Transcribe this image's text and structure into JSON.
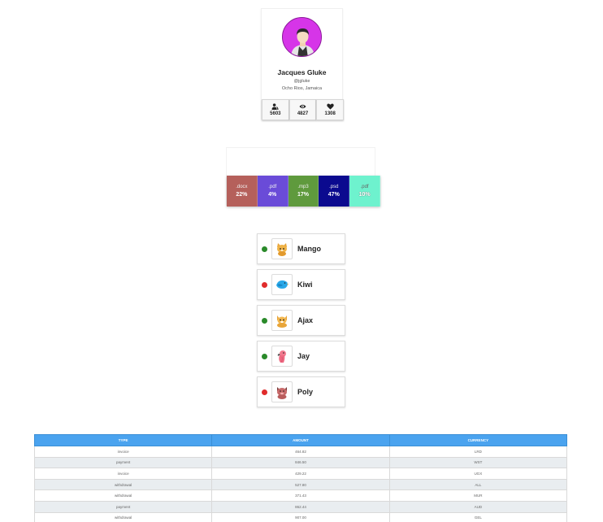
{
  "profile": {
    "name": "Jacques Gluke",
    "handle": "@jgluke",
    "location": "Ocho Rios, Jamaica",
    "avatar_color": "#d635e8",
    "stats": [
      {
        "icon": "followers-icon",
        "value": "5603"
      },
      {
        "icon": "eye-icon",
        "value": "4827"
      },
      {
        "icon": "heart-icon",
        "value": "1308"
      }
    ]
  },
  "file_types": [
    {
      "ext": ".docx",
      "percent": "22%",
      "color": "#b5605b"
    },
    {
      "ext": ".pdf",
      "percent": "4%",
      "color": "#6a4bd8"
    },
    {
      "ext": ".mp3",
      "percent": "17%",
      "color": "#5f9a3d"
    },
    {
      "ext": ".psd",
      "percent": "47%",
      "color": "#0b0a8f"
    },
    {
      "ext": ".pdf",
      "percent": "10%",
      "color": "#6ef2ce"
    }
  ],
  "pets": [
    {
      "name": "Mango",
      "status_color": "#2a8a2a",
      "icon": "cat-icon"
    },
    {
      "name": "Kiwi",
      "status_color": "#e02b2b",
      "icon": "bird-icon"
    },
    {
      "name": "Ajax",
      "status_color": "#2a8a2a",
      "icon": "dog-icon"
    },
    {
      "name": "Jay",
      "status_color": "#2a8a2a",
      "icon": "parrot-icon"
    },
    {
      "name": "Poly",
      "status_color": "#e02b2b",
      "icon": "pig-icon"
    }
  ],
  "table": {
    "headers": [
      "TYPE",
      "AMOUNT",
      "CURRENCY"
    ],
    "rows": [
      [
        "invoice",
        "464.82",
        "LRD"
      ],
      [
        "payment",
        "846.50",
        "WST"
      ],
      [
        "invoice",
        "429.22",
        "UGX"
      ],
      [
        "withdrawal",
        "527.80",
        "ALL"
      ],
      [
        "withdrawal",
        "371.43",
        "MUR"
      ],
      [
        "payment",
        "862.44",
        "AUD"
      ],
      [
        "withdrawal",
        "907.00",
        "GEL"
      ]
    ]
  }
}
